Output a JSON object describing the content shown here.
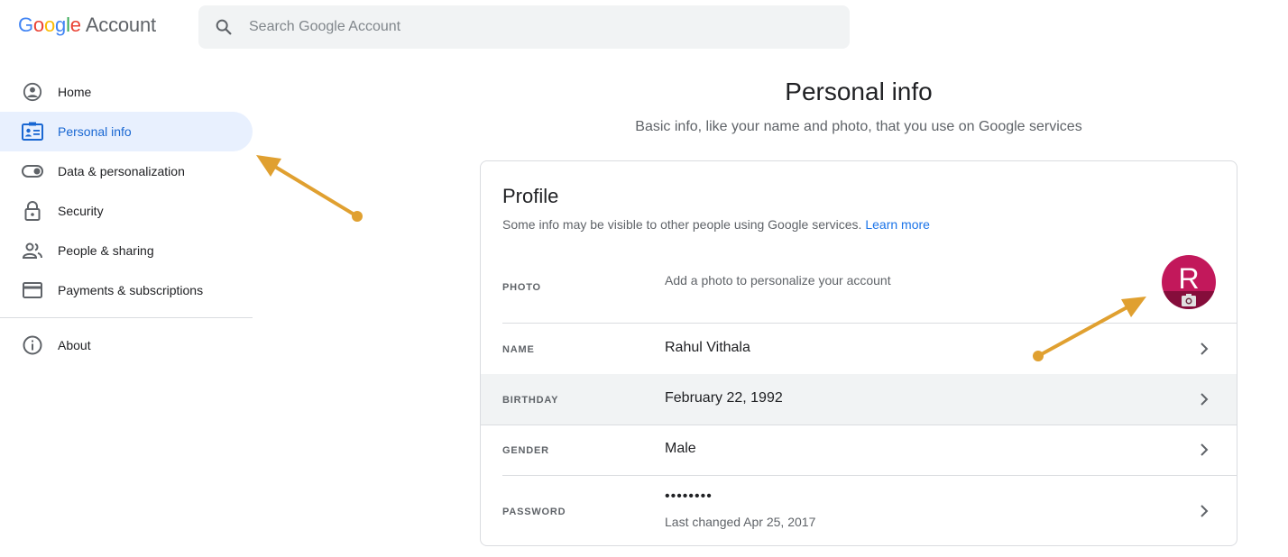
{
  "header": {
    "logo_parts": [
      "G",
      "o",
      "o",
      "g",
      "l",
      "e"
    ],
    "logo_suffix": "Account",
    "search_placeholder": "Search Google Account"
  },
  "sidebar": {
    "items": [
      {
        "label": "Home",
        "icon": "account-circle-icon"
      },
      {
        "label": "Personal info",
        "icon": "id-card-icon",
        "active": true
      },
      {
        "label": "Data & personalization",
        "icon": "toggle-icon"
      },
      {
        "label": "Security",
        "icon": "lock-icon"
      },
      {
        "label": "People & sharing",
        "icon": "people-icon"
      },
      {
        "label": "Payments & subscriptions",
        "icon": "credit-card-icon"
      }
    ],
    "footer_items": [
      {
        "label": "About",
        "icon": "info-icon"
      }
    ]
  },
  "main": {
    "title": "Personal info",
    "subtitle": "Basic info, like your name and photo, that you use on Google services"
  },
  "profile": {
    "title": "Profile",
    "description": "Some info may be visible to other people using Google services.",
    "learn_more": "Learn more",
    "photo_label": "PHOTO",
    "photo_text": "Add a photo to personalize your account",
    "avatar_letter": "R",
    "rows": {
      "name": {
        "label": "NAME",
        "value": "Rahul Vithala"
      },
      "birthday": {
        "label": "BIRTHDAY",
        "value": "February 22, 1992"
      },
      "gender": {
        "label": "GENDER",
        "value": "Male"
      },
      "password": {
        "label": "PASSWORD",
        "value": "••••••••",
        "sub": "Last changed Apr 25, 2017"
      }
    }
  },
  "colors": {
    "accent": "#1a73e8",
    "active_bg": "#e8f0fe",
    "avatar": "#c2185b",
    "annotation_arrow": "#e0a030"
  }
}
